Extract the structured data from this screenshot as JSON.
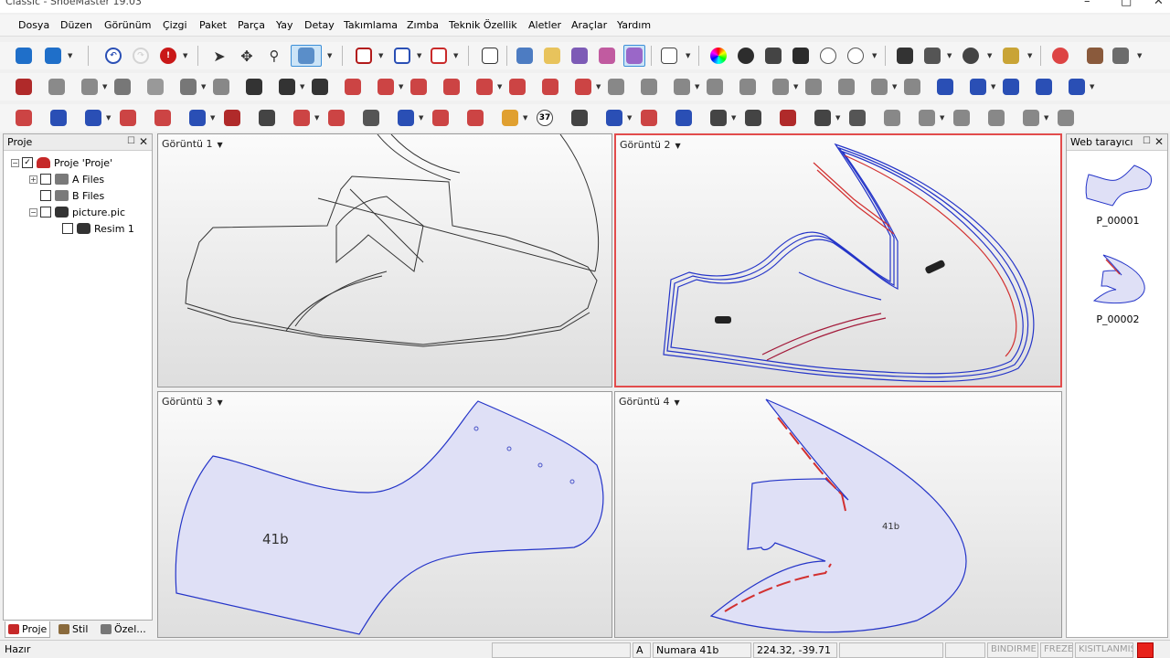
{
  "window": {
    "title": "Classic - ShoeMaster 19.03"
  },
  "menu": [
    "Dosya",
    "Düzen",
    "Görünüm",
    "Çizgi",
    "Paket",
    "Parça",
    "Yay",
    "Detay",
    "Takımlama",
    "Zımba",
    "Teknik Özellik",
    "Aletler",
    "Araçlar",
    "Yardım"
  ],
  "left_panel": {
    "title": "Proje",
    "tree": [
      {
        "label": "Proje 'Proje'",
        "icon": "shoe-icon",
        "checked": true
      },
      {
        "label": "A Files",
        "icon": "folder-icon",
        "checked": false
      },
      {
        "label": "B Files",
        "icon": "folder-icon",
        "checked": false
      },
      {
        "label": "picture.pic",
        "icon": "camera-icon",
        "checked": false
      },
      {
        "label": "Resim 1",
        "icon": "camera-icon",
        "checked": false
      }
    ],
    "tabs": [
      "Proje",
      "Stil",
      "Özel..."
    ],
    "active_tab": "Proje"
  },
  "views": [
    {
      "label": "Görüntü 1",
      "active": false
    },
    {
      "label": "Görüntü 2",
      "active": true
    },
    {
      "label": "Görüntü 3",
      "active": false,
      "piece_label": "41b"
    },
    {
      "label": "Görüntü 4",
      "active": false,
      "piece_label": "41b"
    }
  ],
  "right_panel": {
    "title": "Web tarayıcı",
    "items": [
      {
        "label": "P_00001"
      },
      {
        "label": "P_00002"
      }
    ]
  },
  "toolbar": {
    "size_number": "37"
  },
  "status": {
    "ready": "Hazır",
    "mode": "A",
    "size": "Numara 41b",
    "coords": "224.32, -39.71",
    "flags": [
      "BINDIRME",
      "FREZE",
      "KISITLANMIŞ"
    ],
    "indicator_color": "#e8221b"
  },
  "colors": {
    "accent_blue": "#2434c8",
    "accent_red": "#d23030",
    "piece_fill": "#dfe0f6",
    "active_border": "#e24c4c"
  }
}
